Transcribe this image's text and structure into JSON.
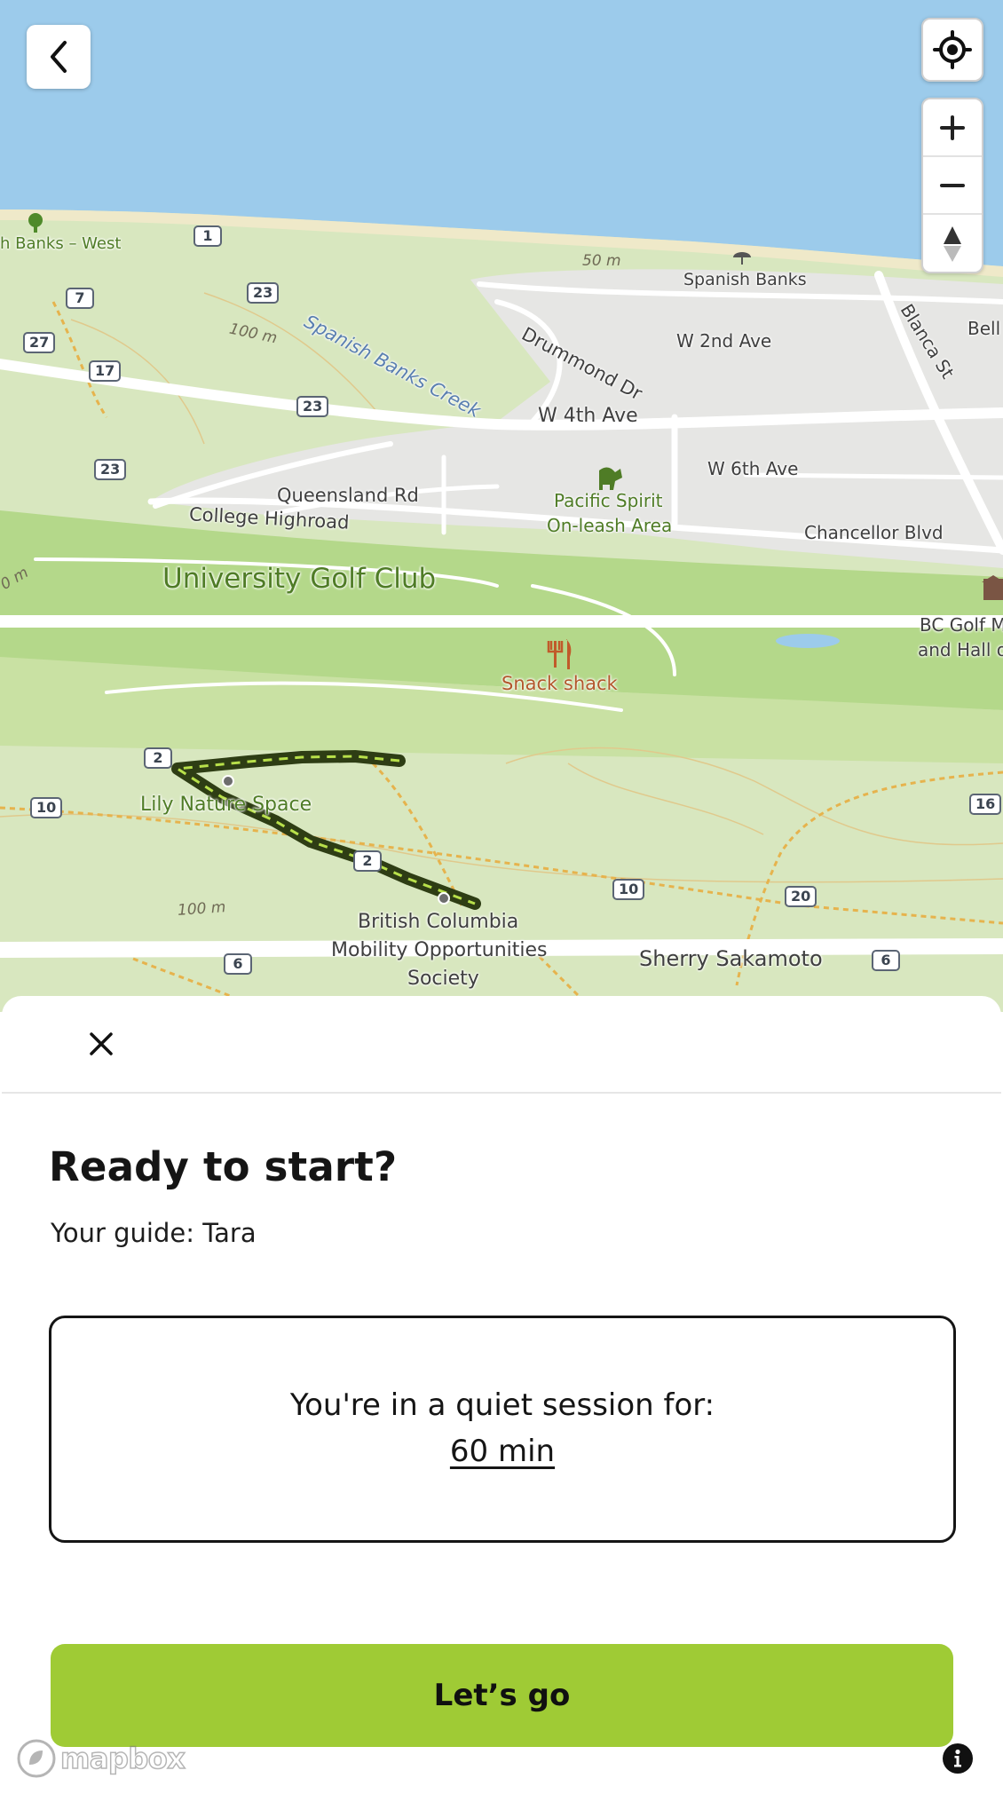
{
  "map": {
    "labels": {
      "spanish_banks_west": "h Banks – West",
      "spanish_banks": "Spanish Banks",
      "spanish_banks_creek": "Spanish Banks Creek",
      "drummond_dr": "Drummond Dr",
      "w_2nd_ave": "W 2nd Ave",
      "blanca_st": "Blanca St",
      "bell": "Bell",
      "w_4th_ave": "W 4th Ave",
      "w_6th_ave": "W 6th Ave",
      "queensland_rd": "Queensland Rd",
      "college_highroad": "College Highroad",
      "pacific_spirit": "Pacific Spirit",
      "on_leash_area": "On-leash Area",
      "chancellor_blvd": "Chancellor Blvd",
      "university_golf_club": "University Golf Club",
      "bc_golf_1": "BC Golf M",
      "bc_golf_2": "and Hall o",
      "snack_shack": "Snack shack",
      "lily_nature_space": "Lily Nature Space",
      "bcmos_1": "British Columbia",
      "bcmos_2": "Mobility Opportunities",
      "bcmos_3": "Society",
      "sherry_sakamoto": "Sherry Sakamoto",
      "contour_100m_a": "100 m",
      "contour_100m_b": "100 m",
      "contour_50m": "50 m",
      "contour_0m": "0 m"
    },
    "shields": {
      "s1": "1",
      "s7": "7",
      "s23a": "23",
      "s27": "27",
      "s17": "17",
      "s23b": "23",
      "s23c": "23",
      "s2a": "2",
      "s10a": "10",
      "s2b": "2",
      "s10b": "10",
      "s20": "20",
      "s16": "16",
      "s6a": "6",
      "s6b": "6"
    },
    "controls": {
      "back_icon": "chevron-left",
      "locate_icon": "crosshair",
      "zoom_in_icon": "plus",
      "zoom_out_icon": "minus",
      "compass_icon": "north-arrow"
    },
    "colors": {
      "water": "#9ccbeb",
      "land": "#d8e7bf",
      "urban": "#e6e6e4",
      "golf": "#b4d88a",
      "route": "#2e3d14",
      "route_dash": "#b8e04a"
    }
  },
  "sheet": {
    "close_icon": "close-x",
    "title": "Ready to start?",
    "guide": "Your guide: Tara",
    "session_text": "You're in a quiet session for:",
    "session_duration": "60 min",
    "go_label": "Let’s go",
    "brand_color": "#9fcb35"
  },
  "attribution": {
    "logo_text": "mapbox",
    "info_icon": "info-circle"
  }
}
